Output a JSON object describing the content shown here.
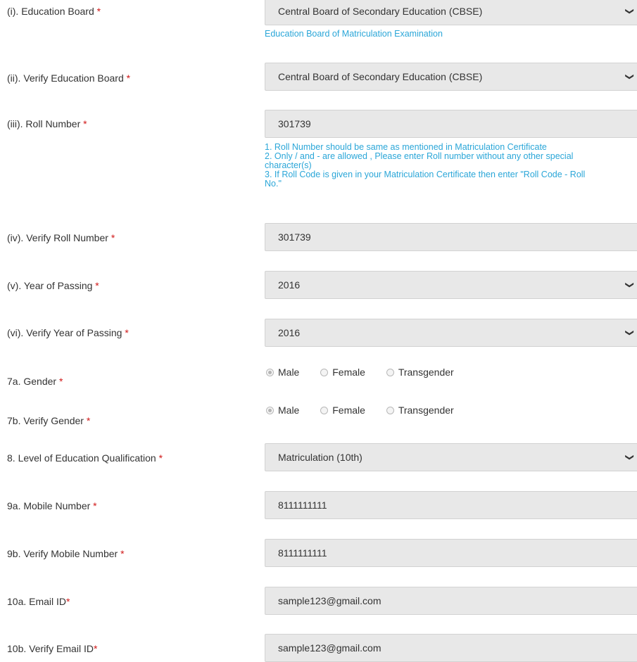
{
  "form": {
    "education_board": {
      "label": "(i). Education Board",
      "required": "*",
      "value": "Central Board of Secondary Education (CBSE)",
      "hint": "Education Board of Matriculation Examination"
    },
    "verify_education_board": {
      "label": "(ii). Verify Education Board",
      "required": "*",
      "value": "Central Board of Secondary Education (CBSE)"
    },
    "roll_number": {
      "label": "(iii). Roll Number",
      "required": "*",
      "value": "301739",
      "hints": [
        "1. Roll Number should be same as mentioned in Matriculation Certificate",
        "2. Only / and - are allowed , Please enter Roll number without any other special",
        "character(s)",
        "3. If Roll Code is given in your Matriculation Certificate then enter \"Roll Code - Roll",
        "No.\""
      ]
    },
    "verify_roll_number": {
      "label": "(iv). Verify Roll Number",
      "required": "*",
      "value": "301739"
    },
    "year_of_passing": {
      "label": "(v). Year of Passing",
      "required": "*",
      "value": "2016"
    },
    "verify_year_of_passing": {
      "label": "(vi). Verify Year of Passing",
      "required": "*",
      "value": "2016"
    },
    "gender": {
      "label": "7a. Gender",
      "required": "*",
      "options": [
        "Male",
        "Female",
        "Transgender"
      ],
      "selected": "Male"
    },
    "verify_gender": {
      "label": "7b. Verify Gender",
      "required": "*",
      "options": [
        "Male",
        "Female",
        "Transgender"
      ],
      "selected": "Male"
    },
    "education_level": {
      "label": "8. Level of Education Qualification",
      "required": "*",
      "value": "Matriculation (10th)"
    },
    "mobile": {
      "label": "9a. Mobile Number",
      "required": "*",
      "value": "8111111111"
    },
    "verify_mobile": {
      "label": "9b. Verify Mobile Number",
      "required": "*",
      "value": "8111111111"
    },
    "email": {
      "label": "10a. Email ID",
      "required": "*",
      "value": "sample123@gmail.com"
    },
    "verify_email": {
      "label": "10b. Verify Email ID",
      "required": "*",
      "value": "sample123@gmail.com"
    }
  },
  "icons": {
    "dropdown": "chevron-down-icon",
    "radio": "radio-icon"
  },
  "colors": {
    "hint": "#2aa6d8",
    "required": "#d01818",
    "field_bg": "#e8e8e8"
  }
}
